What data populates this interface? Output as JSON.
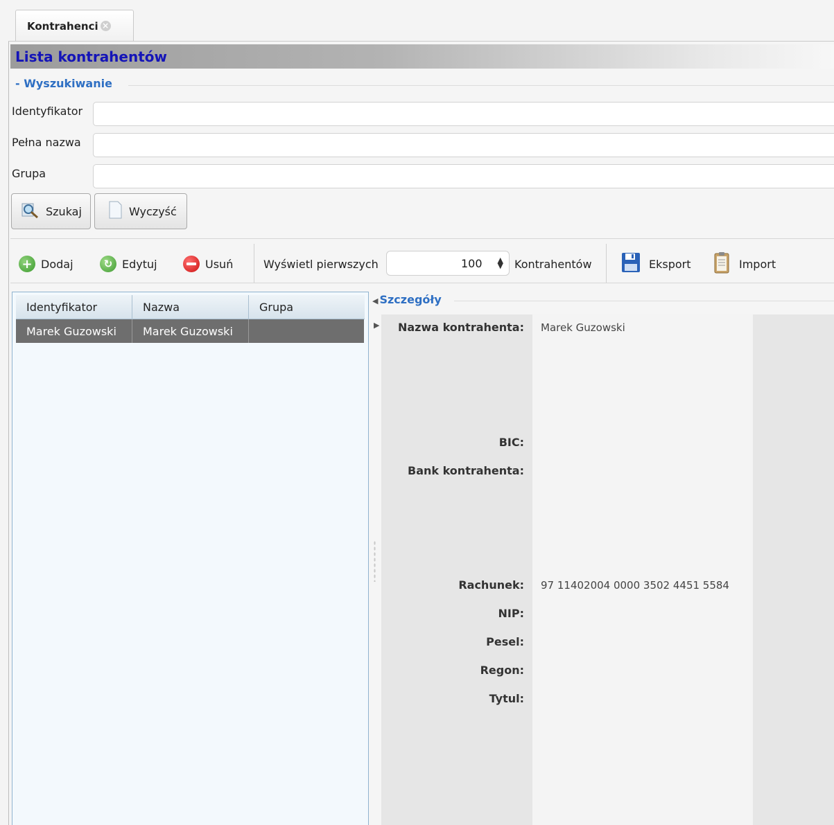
{
  "tab": {
    "label": "Kontrahenci",
    "close_glyph": "×"
  },
  "header": {
    "title": "Lista kontrahentów"
  },
  "search": {
    "legend": "- Wyszukiwanie",
    "fields": [
      {
        "label": "Identyfikator",
        "value": "",
        "placeholder": ""
      },
      {
        "label": "Pełna nazwa",
        "value": "",
        "placeholder": ""
      },
      {
        "label": "Grupa",
        "value": "",
        "placeholder": ""
      }
    ],
    "search_button": "Szukaj",
    "clear_button": "Wyczyść"
  },
  "toolbar": {
    "add": "Dodaj",
    "edit": "Edytuj",
    "delete": "Usuń",
    "show_first": "Wyświetl pierwszych",
    "count": "100",
    "count_suffix": "Kontrahentów",
    "export": "Eksport",
    "import": "Import"
  },
  "grid": {
    "columns": [
      "Identyfikator",
      "Nazwa",
      "Grupa"
    ],
    "rows": [
      {
        "id": "Marek Guzowski",
        "name": "Marek Guzowski",
        "group": ""
      }
    ]
  },
  "details": {
    "legend": "Szczegóły",
    "labels": {
      "name": "Nazwa kontrahenta:",
      "bic": "BIC:",
      "bank": "Bank kontrahenta:",
      "account": "Rachunek:",
      "nip": "NIP:",
      "pesel": "Pesel:",
      "regon": "Regon:",
      "title": "Tytul:"
    },
    "values": {
      "name": "Marek Guzowski",
      "account": "97 11402004 0000 3502 4451 5584"
    }
  },
  "colors": {
    "header_title": "#1414b8",
    "legend": "#2e6fc3",
    "selected_row": "#6e6e6e",
    "grid_border": "#8fb3cf"
  }
}
